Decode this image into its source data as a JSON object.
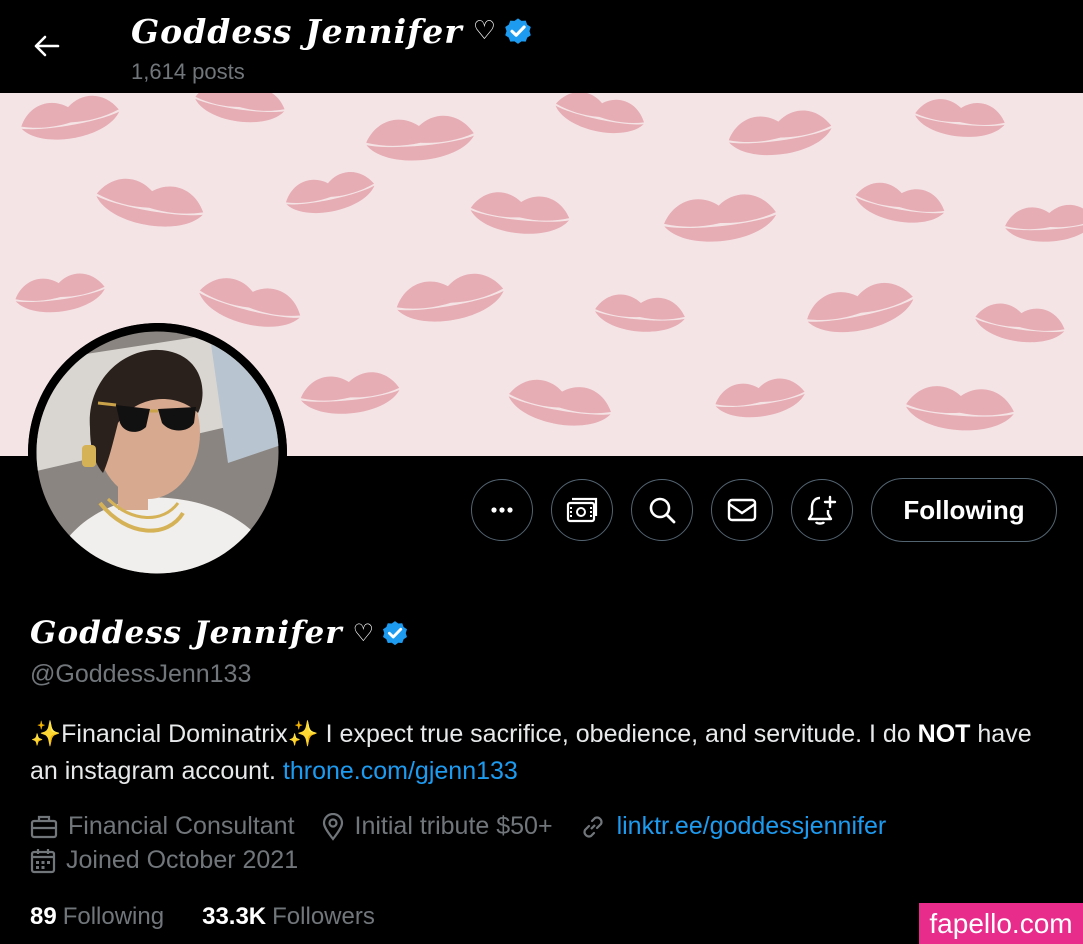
{
  "header": {
    "display_name": "Goddess Jennifer",
    "heart": "♡",
    "posts": "1,614 posts"
  },
  "actions": {
    "more_icon": "more-icon",
    "subscribe_icon": "money-icon",
    "search_icon": "search-icon",
    "message_icon": "mail-icon",
    "notify_icon": "bell-plus-icon",
    "following_label": "Following"
  },
  "profile": {
    "display_name": "Goddess Jennifer",
    "heart": "♡",
    "handle": "@GoddessJenn133",
    "bio_part1": "✨Financial Dominatrix✨ I expect true sacrifice, obedience, and servitude. I do ",
    "bio_bold": "NOT",
    "bio_part2": " have an instagram account. ",
    "bio_link": "throne.com/gjenn133",
    "profession": "Financial Consultant",
    "location": "Initial tribute $50+",
    "website": "linktr.ee/goddessjennifer",
    "joined": "Joined October 2021",
    "following_count": "89",
    "following_label": "Following",
    "followers_count": "33.3K",
    "followers_label": "Followers"
  },
  "watermark": "fapello.com",
  "colors": {
    "background": "#000000",
    "accent": "#1d9bf0",
    "muted": "#71767b",
    "watermark": "#e82c8c"
  }
}
